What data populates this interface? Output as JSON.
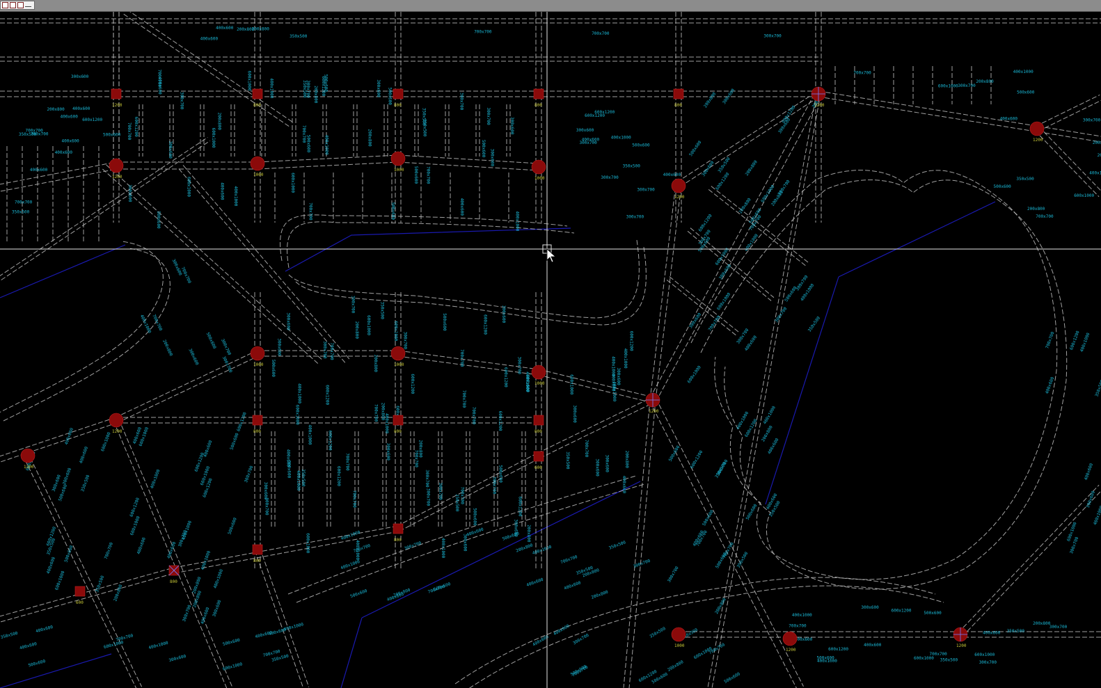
{
  "window": {
    "controls": [
      "restore",
      "tile",
      "copy",
      "minimize"
    ]
  },
  "colors": {
    "background": "#000000",
    "road_edge": "#bdbdbd",
    "dimension_text": "#1ab8d6",
    "node_fill": "#8b0a0a",
    "node_label": "#c8c837",
    "boundary": "#1a1ab0",
    "crosshair": "#e6e6e6"
  },
  "cad": {
    "cursor": {
      "type": "crosshair",
      "pickbox": true,
      "icon": "arrow-cursor-icon"
    },
    "dimension_labels": [
      "300x700",
      "400x600",
      "500x600",
      "600x1200",
      "300x600",
      "700x700",
      "600x1000",
      "200x800",
      "400x1000",
      "350x500"
    ],
    "node_labels": [
      "1200",
      "1000",
      "800",
      "600"
    ]
  }
}
